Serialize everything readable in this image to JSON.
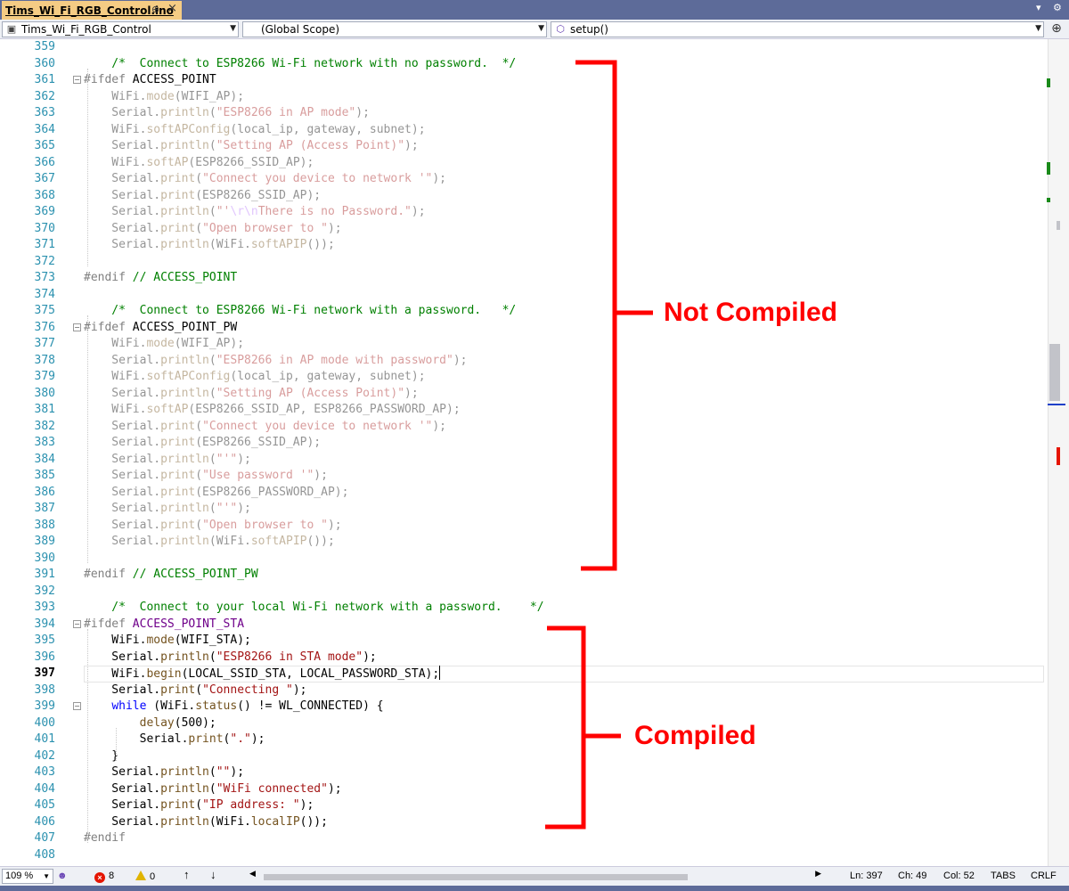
{
  "tab": {
    "title": "Tims_Wi_Fi_RGB_Control.ino",
    "pin": "⊕",
    "close": "×"
  },
  "navbar": {
    "project": "Tims_Wi_Fi_RGB_Control",
    "scope": "(Global Scope)",
    "member": "setup()"
  },
  "annotations": {
    "not_compiled": "Not Compiled",
    "compiled": "Compiled"
  },
  "status": {
    "zoom": "109 %",
    "errors": "8",
    "warnings": "0",
    "ln": "Ln: 397",
    "ch": "Ch: 49",
    "col": "Col: 52",
    "tabs": "TABS",
    "eol": "CRLF"
  },
  "lines": [
    {
      "n": "359",
      "t": ""
    },
    {
      "n": "360",
      "t": "    /*  Connect to ESP8266 Wi-Fi network with no password.  */"
    },
    {
      "n": "361",
      "t": "#ifdef ACCESS_POINT"
    },
    {
      "n": "362",
      "t": "    WiFi.mode(WIFI_AP);"
    },
    {
      "n": "363",
      "t": "    Serial.println(\"ESP8266 in AP mode\");"
    },
    {
      "n": "364",
      "t": "    WiFi.softAPConfig(local_ip, gateway, subnet);"
    },
    {
      "n": "365",
      "t": "    Serial.println(\"Setting AP (Access Point)\");"
    },
    {
      "n": "366",
      "t": "    WiFi.softAP(ESP8266_SSID_AP);"
    },
    {
      "n": "367",
      "t": "    Serial.print(\"Connect you device to network '\");"
    },
    {
      "n": "368",
      "t": "    Serial.print(ESP8266_SSID_AP);"
    },
    {
      "n": "369",
      "t": "    Serial.println(\"'\\r\\nThere is no Password.\");"
    },
    {
      "n": "370",
      "t": "    Serial.print(\"Open browser to \");"
    },
    {
      "n": "371",
      "t": "    Serial.println(WiFi.softAPIP());"
    },
    {
      "n": "372",
      "t": ""
    },
    {
      "n": "373",
      "t": "#endif // ACCESS_POINT"
    },
    {
      "n": "374",
      "t": ""
    },
    {
      "n": "375",
      "t": "    /*  Connect to ESP8266 Wi-Fi network with a password.   */"
    },
    {
      "n": "376",
      "t": "#ifdef ACCESS_POINT_PW"
    },
    {
      "n": "377",
      "t": "    WiFi.mode(WIFI_AP);"
    },
    {
      "n": "378",
      "t": "    Serial.println(\"ESP8266 in AP mode with password\");"
    },
    {
      "n": "379",
      "t": "    WiFi.softAPConfig(local_ip, gateway, subnet);"
    },
    {
      "n": "380",
      "t": "    Serial.println(\"Setting AP (Access Point)\");"
    },
    {
      "n": "381",
      "t": "    WiFi.softAP(ESP8266_SSID_AP, ESP8266_PASSWORD_AP);"
    },
    {
      "n": "382",
      "t": "    Serial.print(\"Connect you device to network '\");"
    },
    {
      "n": "383",
      "t": "    Serial.print(ESP8266_SSID_AP);"
    },
    {
      "n": "384",
      "t": "    Serial.println(\"'\");"
    },
    {
      "n": "385",
      "t": "    Serial.print(\"Use password '\");"
    },
    {
      "n": "386",
      "t": "    Serial.print(ESP8266_PASSWORD_AP);"
    },
    {
      "n": "387",
      "t": "    Serial.println(\"'\");"
    },
    {
      "n": "388",
      "t": "    Serial.print(\"Open browser to \");"
    },
    {
      "n": "389",
      "t": "    Serial.println(WiFi.softAPIP());"
    },
    {
      "n": "390",
      "t": ""
    },
    {
      "n": "391",
      "t": "#endif // ACCESS_POINT_PW"
    },
    {
      "n": "392",
      "t": ""
    },
    {
      "n": "393",
      "t": "    /*  Connect to your local Wi-Fi network with a password.    */"
    },
    {
      "n": "394",
      "t": "#ifdef ACCESS_POINT_STA"
    },
    {
      "n": "395",
      "t": "    WiFi.mode(WIFI_STA);"
    },
    {
      "n": "396",
      "t": "    Serial.println(\"ESP8266 in STA mode\");"
    },
    {
      "n": "397",
      "t": "    WiFi.begin(LOCAL_SSID_STA, LOCAL_PASSWORD_STA);"
    },
    {
      "n": "398",
      "t": "    Serial.print(\"Connecting \");"
    },
    {
      "n": "399",
      "t": "    while (WiFi.status() != WL_CONNECTED) {"
    },
    {
      "n": "400",
      "t": "        delay(500);"
    },
    {
      "n": "401",
      "t": "        Serial.print(\".\");"
    },
    {
      "n": "402",
      "t": "    }"
    },
    {
      "n": "403",
      "t": "    Serial.println(\"\");"
    },
    {
      "n": "404",
      "t": "    Serial.println(\"WiFi connected\");"
    },
    {
      "n": "405",
      "t": "    Serial.print(\"IP address: \");"
    },
    {
      "n": "406",
      "t": "    Serial.println(WiFi.localIP());"
    },
    {
      "n": "407",
      "t": "#endif"
    },
    {
      "n": "408",
      "t": ""
    }
  ]
}
